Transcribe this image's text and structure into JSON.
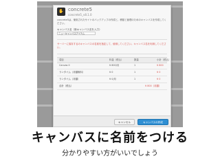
{
  "modal": {
    "brand": "concrete5",
    "version": "concrete5_v8.1.0",
    "description": "concrete5は、使用されたサイトのバックアップの作成と、移動と管理のためのキャンバスを作成してください。",
    "fieldset_label": "キャンバス名（新キャンバス名を入力）",
    "name_value": "ニューキャンバスアイテム",
    "warning": "サーバーに保存するのキャンバスの名前を指定して、使用してください。キャンバス名を利用してください。",
    "table": {
      "headers": [
        "項目",
        "料金（税込）",
        "数量",
        "小計（税込）"
      ],
      "rows": [
        [
          "Canvas II",
          "¥ 800/月",
          "1",
          "¥ 800"
        ],
        [
          "ランタイム（月額無料）",
          "¥ 0",
          "1",
          "¥ 0"
        ],
        [
          "ランタイム（月額）",
          "¥ 0/月",
          "1",
          "¥ 0"
        ]
      ],
      "total_label": "合計（税込）",
      "total_value": "¥ 800（月額）"
    },
    "cancel_label": "キャンセル",
    "ok_label": "キャンバスの作成"
  },
  "title": "キャンバスに名前をつける",
  "subtitle": "分かりやすい方がいいでしょう",
  "colors": {
    "accent": "#2f8fd3",
    "warning": "#d9534f"
  }
}
